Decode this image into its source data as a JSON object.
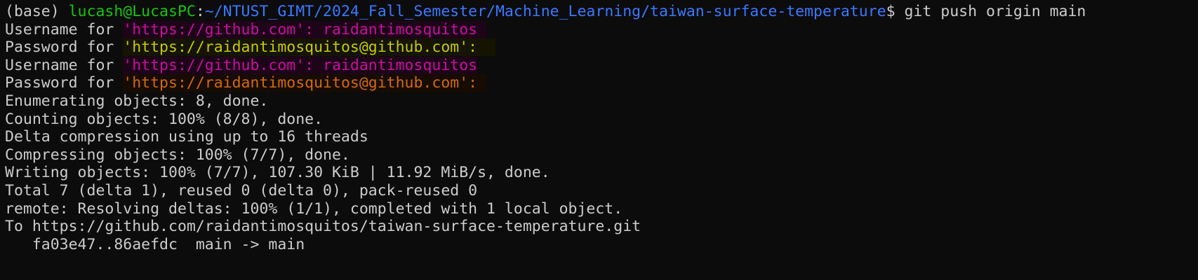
{
  "prompt": {
    "env": "(base) ",
    "user_host": "lucash@LucasPC",
    "sep": ":",
    "path": "~/NTUST_GIMT/2024_Fall_Semester/Machine_Learning/taiwan-surface-temperature",
    "symbol": "$ ",
    "command": "git push origin main"
  },
  "auth": [
    {
      "label": "Username for ",
      "url": "'https://github.com'",
      "suffix": ": raidantimosquitos",
      "color": "magenta"
    },
    {
      "label": "Password for ",
      "url": "'https://raidantimosquitos@github.com'",
      "suffix": ":",
      "color": "yellow"
    },
    {
      "label": "Username for ",
      "url": "'https://github.com'",
      "suffix": ": raidantimosquitos",
      "color": "magenta"
    },
    {
      "label": "Password for ",
      "url": "'https://raidantimosquitos@github.com'",
      "suffix": ":",
      "color": "orange"
    }
  ],
  "output": [
    "Enumerating objects: 8, done.",
    "Counting objects: 100% (8/8), done.",
    "Delta compression using up to 16 threads",
    "Compressing objects: 100% (7/7), done.",
    "Writing objects: 100% (7/7), 107.30 KiB | 11.92 MiB/s, done.",
    "Total 7 (delta 1), reused 0 (delta 0), pack-reused 0",
    "remote: Resolving deltas: 100% (1/1), completed with 1 local object.",
    "To https://github.com/raidantimosquitos/taiwan-surface-temperature.git",
    "   fa03e47..86aefdc  main -> main"
  ]
}
